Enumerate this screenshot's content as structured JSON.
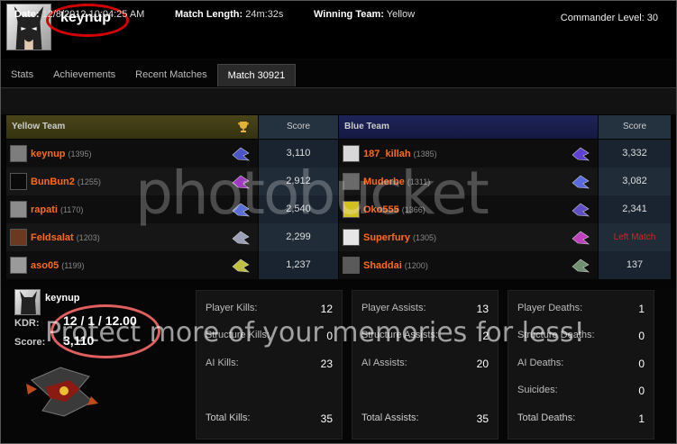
{
  "header": {
    "username": "keynup",
    "commander_level": "Commander Level: 30"
  },
  "tabs": [
    {
      "label": "Stats"
    },
    {
      "label": "Achievements"
    },
    {
      "label": "Recent Matches"
    },
    {
      "label": "Match 30921"
    }
  ],
  "match_info": {
    "date_label": "Date:",
    "date_value": "12/8/2012 10:04:25 AM",
    "length_label": "Match Length:",
    "length_value": "24m:32s",
    "winner_label": "Winning Team:",
    "winner_value": "Yellow"
  },
  "teams": {
    "yellow": {
      "label": "Yellow Team",
      "score_header": "Score",
      "players": [
        {
          "name": "keynup",
          "level": "(1395)",
          "score": "3,110"
        },
        {
          "name": "BunBun2",
          "level": "(1255)",
          "score": "2,912"
        },
        {
          "name": "rapati",
          "level": "(1170)",
          "score": "2,540"
        },
        {
          "name": "Feldsalat",
          "level": "(1203)",
          "score": "2,299"
        },
        {
          "name": "aso05",
          "level": "(1199)",
          "score": "1,237"
        }
      ]
    },
    "blue": {
      "label": "Blue Team",
      "score_header": "Score",
      "players": [
        {
          "name": "187_killah",
          "level": "(1385)",
          "score": "3,332"
        },
        {
          "name": "Muderbe",
          "level": "(1311)",
          "score": "3,082"
        },
        {
          "name": "Oko555",
          "level": "(1366)",
          "score": "2,341"
        },
        {
          "name": "Superfury",
          "level": "(1305)",
          "score": "Left Match"
        },
        {
          "name": "Shaddai",
          "level": "(1200)",
          "score": "137"
        }
      ]
    }
  },
  "player_summary": {
    "name": "keynup",
    "kdr_label": "KDR:",
    "kdr_value": "12 / 1 / 12.00",
    "score_label": "Score:",
    "score_value": "3,110"
  },
  "kills": {
    "player_kills": {
      "label": "Player Kills:",
      "value": "12"
    },
    "structure_kills": {
      "label": "Structure Kills:",
      "value": "0"
    },
    "ai_kills": {
      "label": "AI Kills:",
      "value": "23"
    },
    "total_kills": {
      "label": "Total Kills:",
      "value": "35"
    }
  },
  "assists": {
    "player_assists": {
      "label": "Player Assists:",
      "value": "13"
    },
    "structure_assists": {
      "label": "Structure Assists:",
      "value": "2"
    },
    "ai_assists": {
      "label": "AI Assists:",
      "value": "20"
    },
    "total_assists": {
      "label": "Total Assists:",
      "value": "35"
    }
  },
  "deaths": {
    "player_deaths": {
      "label": "Player Deaths:",
      "value": "1"
    },
    "structure_deaths": {
      "label": "Structure Deaths:",
      "value": "0"
    },
    "ai_deaths": {
      "label": "AI Deaths:",
      "value": "0"
    },
    "suicides": {
      "label": "Suicides:",
      "value": "0"
    },
    "total_deaths": {
      "label": "Total Deaths:",
      "value": "1"
    }
  },
  "watermark": {
    "brand": "photobucket",
    "tagline": "Protect more of your memories for less!"
  },
  "colors": {
    "player_name": "#ff6a1a",
    "left_match": "#e02020",
    "annotation_red": "#d40000"
  }
}
